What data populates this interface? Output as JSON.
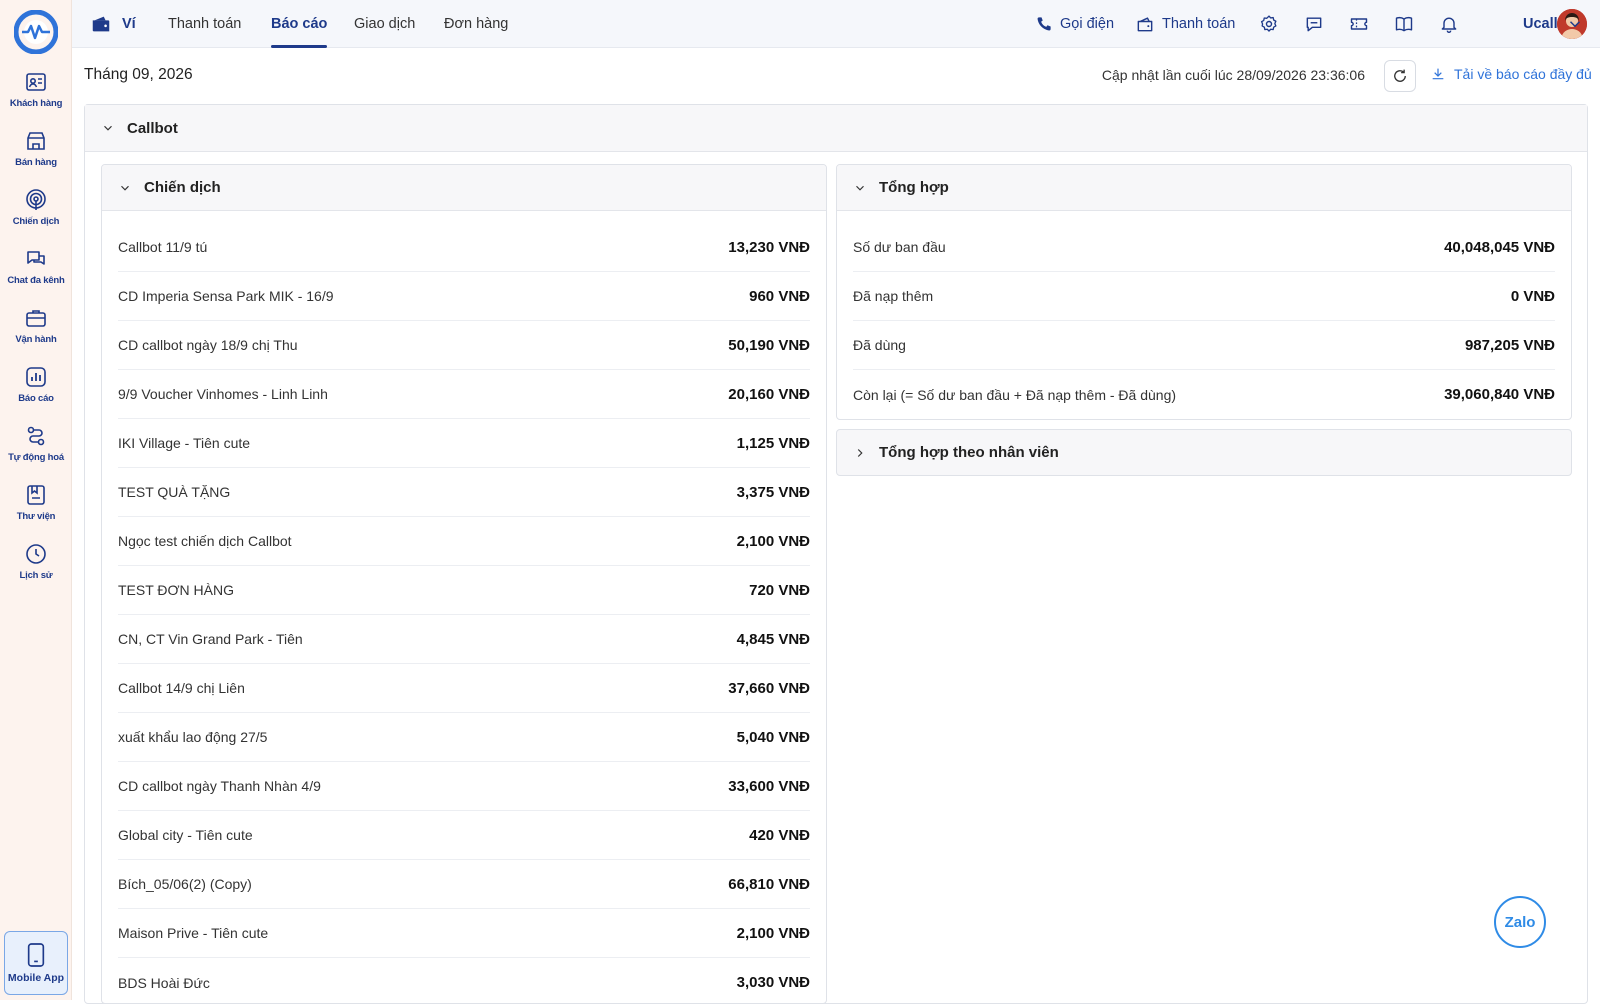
{
  "sidebar": {
    "items": [
      {
        "label": "Khách hàng",
        "icon": "customer-card-icon"
      },
      {
        "label": "Bán hàng",
        "icon": "store-icon"
      },
      {
        "label": "Chiến dịch",
        "icon": "broadcast-icon"
      },
      {
        "label": "Chat đa kênh",
        "icon": "chat-icon"
      },
      {
        "label": "Vận hành",
        "icon": "briefcase-icon"
      },
      {
        "label": "Báo cáo",
        "icon": "bar-chart-icon"
      },
      {
        "label": "Tự động hoá",
        "icon": "workflow-icon"
      },
      {
        "label": "Thư viện",
        "icon": "library-icon"
      },
      {
        "label": "Lịch sử",
        "icon": "clock-icon"
      }
    ],
    "mobile_app_label": "Mobile App"
  },
  "topbar": {
    "tabs": [
      {
        "label": "Ví"
      },
      {
        "label": "Thanh toán"
      },
      {
        "label": "Báo cáo"
      },
      {
        "label": "Giao dịch"
      },
      {
        "label": "Đơn hàng"
      }
    ],
    "active_tab": "Báo cáo",
    "call_label": "Gọi điện",
    "pay_label": "Thanh toán",
    "user_name": "Ucall"
  },
  "header": {
    "month": "Tháng 09, 2026",
    "updated": "Cập nhật lần cuối lúc 28/09/2026 23:36:06",
    "download": "Tải về báo cáo đầy đủ"
  },
  "callbot": {
    "title": "Callbot",
    "campaigns": {
      "title": "Chiến dịch",
      "rows": [
        {
          "name": "Callbot 11/9 tú",
          "value": "13,230 VNĐ"
        },
        {
          "name": "CD Imperia Sensa Park MIK - 16/9",
          "value": "960 VNĐ"
        },
        {
          "name": "CD callbot ngày 18/9 chị Thu",
          "value": "50,190 VNĐ"
        },
        {
          "name": "9/9 Voucher Vinhomes - Linh Linh",
          "value": "20,160 VNĐ"
        },
        {
          "name": "IKI Village - Tiên cute",
          "value": "1,125 VNĐ"
        },
        {
          "name": "TEST QUÀ TẶNG",
          "value": "3,375 VNĐ"
        },
        {
          "name": "Ngọc test chiến dịch Callbot",
          "value": "2,100 VNĐ"
        },
        {
          "name": "TEST ĐƠN HÀNG",
          "value": "720 VNĐ"
        },
        {
          "name": "CN, CT Vin Grand Park - Tiên",
          "value": "4,845 VNĐ"
        },
        {
          "name": "Callbot 14/9 chị Liên",
          "value": "37,660 VNĐ"
        },
        {
          "name": "xuất khẩu lao động 27/5",
          "value": "5,040 VNĐ"
        },
        {
          "name": "CD callbot ngày Thanh Nhàn 4/9",
          "value": "33,600 VNĐ"
        },
        {
          "name": "Global city - Tiên cute",
          "value": "420 VNĐ"
        },
        {
          "name": "Bích_05/06(2) (Copy)",
          "value": "66,810 VNĐ"
        },
        {
          "name": "Maison Prive - Tiên cute",
          "value": "2,100 VNĐ"
        },
        {
          "name": "BDS Hoài Đức",
          "value": "3,030 VNĐ"
        }
      ]
    },
    "summary": {
      "title": "Tổng hợp",
      "rows": [
        {
          "name": "Số dư ban đầu",
          "value": "40,048,045 VNĐ"
        },
        {
          "name": "Đã nạp thêm",
          "value": "0 VNĐ"
        },
        {
          "name": "Đã dùng",
          "value": "987,205 VNĐ"
        },
        {
          "name": "Còn lại (= Số dư ban đầu + Đã nạp thêm - Đã dùng)",
          "value": "39,060,840 VNĐ"
        }
      ]
    },
    "by_staff_title": "Tổng hợp theo nhân viên"
  },
  "zalo_label": "Zalo",
  "colors": {
    "brand": "#1e3a8a",
    "accent": "#2f73d9",
    "sidebar_bg": "#fdf3ee"
  }
}
